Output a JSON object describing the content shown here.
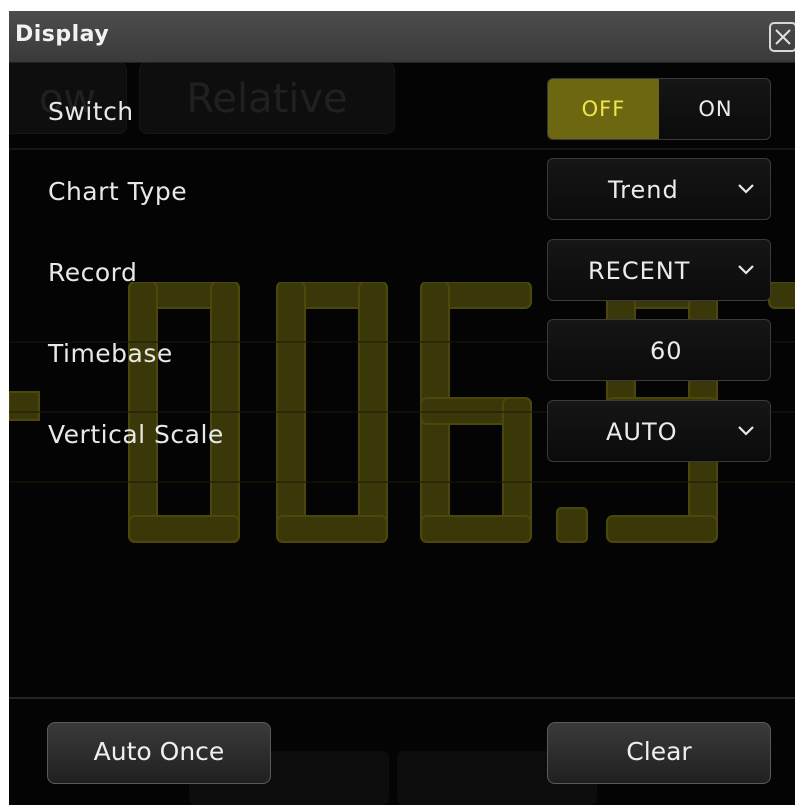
{
  "dialog": {
    "title": "Display",
    "close_icon": "close-icon"
  },
  "background": {
    "tab_left": "ow",
    "tab_right": "Relative",
    "reading": "-006.9"
  },
  "settings": {
    "switch": {
      "label": "Switch",
      "off_label": "OFF",
      "on_label": "ON",
      "selected": "OFF",
      "accent": "#6c6710",
      "accent_text": "#f0e64a"
    },
    "chart_type": {
      "label": "Chart Type",
      "value": "Trend",
      "icon": "chevron-down-icon"
    },
    "record": {
      "label": "Record",
      "value": "RECENT",
      "icon": "chevron-down-icon"
    },
    "timebase": {
      "label": "Timebase",
      "value": "60"
    },
    "vertical_scale": {
      "label": "Vertical Scale",
      "value": "AUTO",
      "icon": "chevron-down-icon"
    }
  },
  "footer": {
    "auto_once_label": "Auto Once",
    "clear_label": "Clear"
  }
}
